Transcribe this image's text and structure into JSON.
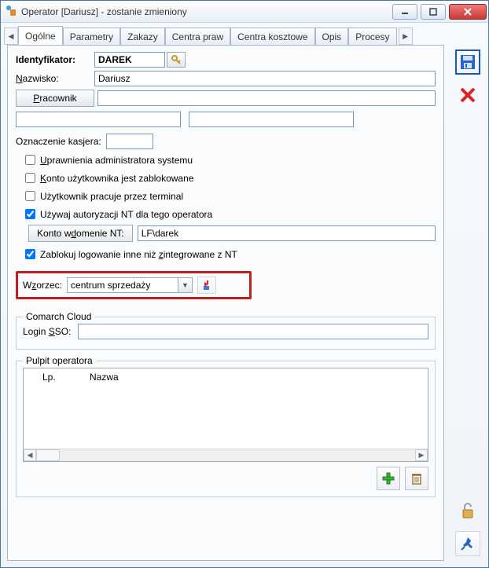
{
  "window": {
    "title": "Operator [Dariusz] - zostanie zmieniony"
  },
  "tabs": {
    "general": "Ogólne",
    "params": "Parametry",
    "bans": "Zakazy",
    "rights": "Centra praw",
    "cost": "Centra kosztowe",
    "desc": "Opis",
    "proc": "Procesy"
  },
  "form": {
    "ident_label": "Identyfikator:",
    "ident_value": "DAREK",
    "surname_label": "Nazwisko:",
    "surname_value": "Dariusz",
    "employee_btn": "Pracownik",
    "cashier_label": "Oznaczenie kasjera:",
    "chk_admin": "Uprawnienia administratora systemu",
    "chk_locked": "Konto użytkownika jest zablokowane",
    "chk_terminal": "Użytkownik pracuje przez terminal",
    "chk_ntauth": "Używaj autoryzacji NT dla tego operatora",
    "nt_btn": "Konto w domenie NT:",
    "nt_value": "LF\\darek",
    "chk_block_nonnt": "Zablokuj logowanie inne niż zintegrowane z NT"
  },
  "wzorzec": {
    "label": "Wzorzec:",
    "value": "centrum sprzedaży"
  },
  "cloud": {
    "legend": "Comarch Cloud",
    "sso_label": "Login SSO:"
  },
  "pulpit": {
    "legend": "Pulpit operatora",
    "col_lp": "Lp.",
    "col_name": "Nazwa"
  }
}
